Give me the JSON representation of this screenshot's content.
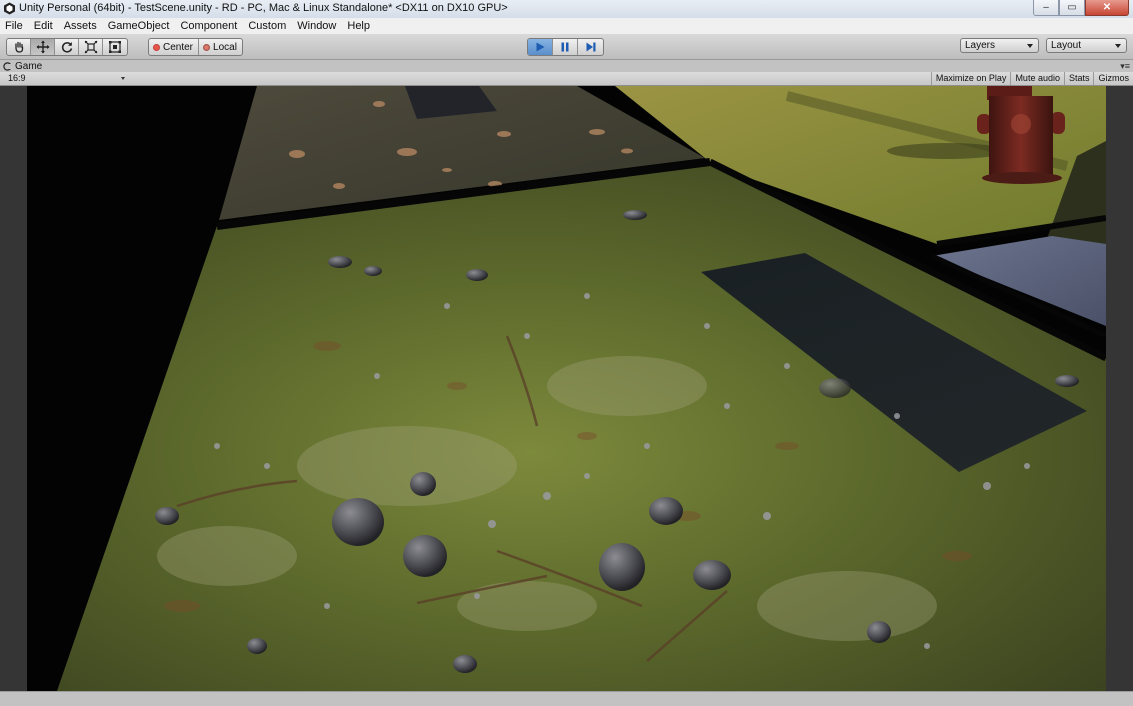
{
  "window": {
    "title": "Unity Personal (64bit) - TestScene.unity - RD - PC, Mac & Linux Standalone* <DX11 on DX10 GPU>",
    "min_glyph": "–",
    "max_glyph": "▭",
    "close_glyph": "✕"
  },
  "menu": [
    "File",
    "Edit",
    "Assets",
    "GameObject",
    "Component",
    "Custom",
    "Window",
    "Help"
  ],
  "toolbar": {
    "transform_tools": [
      "hand-icon",
      "move-icon",
      "rotate-icon",
      "scale-icon",
      "rect-tool-icon"
    ],
    "active_tool": "move-icon",
    "pivot_label": "Center",
    "rotation_label": "Local",
    "play_controls": [
      "play-icon",
      "pause-icon",
      "step-icon"
    ],
    "layers_label": "Layers",
    "layout_label": "Layout"
  },
  "game_tab": {
    "label": "Game",
    "aspect": "16:9",
    "buttons": [
      "Maximize on Play",
      "Mute audio",
      "Stats",
      "Gizmos"
    ]
  },
  "colors": {
    "accent_blue": "#3b78c8",
    "play_active": "#5b8fcb",
    "panel_bg": "#c2c2c2",
    "ground_moss": "#5f6a2e",
    "grass": "#8d8a3a",
    "hydrant": "#6e231b"
  }
}
